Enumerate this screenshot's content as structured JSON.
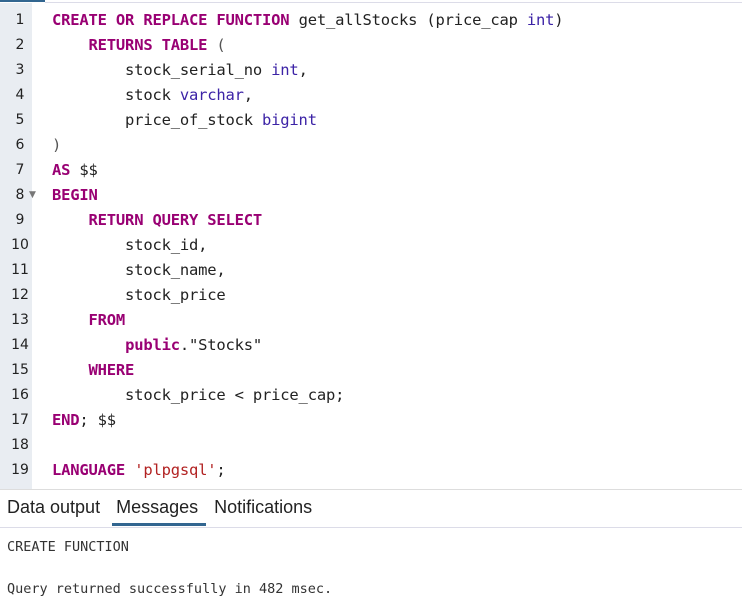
{
  "editor": {
    "fold_marker_line": 8,
    "lines": [
      {
        "num": "1",
        "tokens": [
          {
            "t": "CREATE OR REPLACE FUNCTION",
            "c": "kw"
          },
          {
            "t": " get_allStocks (price_cap ",
            "c": "plain"
          },
          {
            "t": "int",
            "c": "type"
          },
          {
            "t": ")",
            "c": "plain"
          }
        ]
      },
      {
        "num": "2",
        "tokens": [
          {
            "t": "    ",
            "c": "plain"
          },
          {
            "t": "RETURNS TABLE",
            "c": "kw"
          },
          {
            "t": " (",
            "c": "punct"
          }
        ]
      },
      {
        "num": "3",
        "tokens": [
          {
            "t": "        stock_serial_no ",
            "c": "plain"
          },
          {
            "t": "int",
            "c": "type"
          },
          {
            "t": ",",
            "c": "plain"
          }
        ]
      },
      {
        "num": "4",
        "tokens": [
          {
            "t": "        stock ",
            "c": "plain"
          },
          {
            "t": "varchar",
            "c": "type"
          },
          {
            "t": ",",
            "c": "plain"
          }
        ]
      },
      {
        "num": "5",
        "tokens": [
          {
            "t": "        price_of_stock ",
            "c": "plain"
          },
          {
            "t": "bigint",
            "c": "type"
          }
        ]
      },
      {
        "num": "6",
        "tokens": [
          {
            "t": ")",
            "c": "punct"
          }
        ]
      },
      {
        "num": "7",
        "tokens": [
          {
            "t": "AS",
            "c": "kw"
          },
          {
            "t": " $$",
            "c": "plain"
          }
        ]
      },
      {
        "num": "8",
        "tokens": [
          {
            "t": "BEGIN",
            "c": "kw"
          }
        ]
      },
      {
        "num": "9",
        "tokens": [
          {
            "t": "    ",
            "c": "plain"
          },
          {
            "t": "RETURN QUERY SELECT",
            "c": "kw"
          }
        ]
      },
      {
        "num": "10",
        "tokens": [
          {
            "t": "        stock_id,",
            "c": "plain"
          }
        ]
      },
      {
        "num": "11",
        "tokens": [
          {
            "t": "        stock_name,",
            "c": "plain"
          }
        ]
      },
      {
        "num": "12",
        "tokens": [
          {
            "t": "        stock_price",
            "c": "plain"
          }
        ]
      },
      {
        "num": "13",
        "tokens": [
          {
            "t": "    ",
            "c": "plain"
          },
          {
            "t": "FROM",
            "c": "kw"
          }
        ]
      },
      {
        "num": "14",
        "tokens": [
          {
            "t": "        ",
            "c": "plain"
          },
          {
            "t": "public",
            "c": "kw"
          },
          {
            "t": ".\"Stocks\"",
            "c": "plain"
          }
        ]
      },
      {
        "num": "15",
        "tokens": [
          {
            "t": "    ",
            "c": "plain"
          },
          {
            "t": "WHERE",
            "c": "kw"
          }
        ]
      },
      {
        "num": "16",
        "tokens": [
          {
            "t": "        stock_price < price_cap;",
            "c": "plain"
          }
        ]
      },
      {
        "num": "17",
        "tokens": [
          {
            "t": "END",
            "c": "kw"
          },
          {
            "t": "; $$",
            "c": "plain"
          }
        ]
      },
      {
        "num": "18",
        "tokens": []
      },
      {
        "num": "19",
        "tokens": [
          {
            "t": "LANGUAGE",
            "c": "kw"
          },
          {
            "t": " ",
            "c": "plain"
          },
          {
            "t": "'plpgsql'",
            "c": "str"
          },
          {
            "t": ";",
            "c": "plain"
          }
        ]
      }
    ]
  },
  "output_tabs": {
    "active": "messages",
    "items": [
      {
        "id": "data-output",
        "label": "Data output"
      },
      {
        "id": "messages",
        "label": "Messages"
      },
      {
        "id": "notifications",
        "label": "Notifications"
      }
    ]
  },
  "messages": {
    "result": "CREATE FUNCTION",
    "status": "Query returned successfully in 482 msec."
  },
  "colors": {
    "accent": "#326690",
    "keyword": "#990073",
    "type": "#3c23a6",
    "string": "#b22222",
    "gutter_bg": "#e9edf2"
  }
}
